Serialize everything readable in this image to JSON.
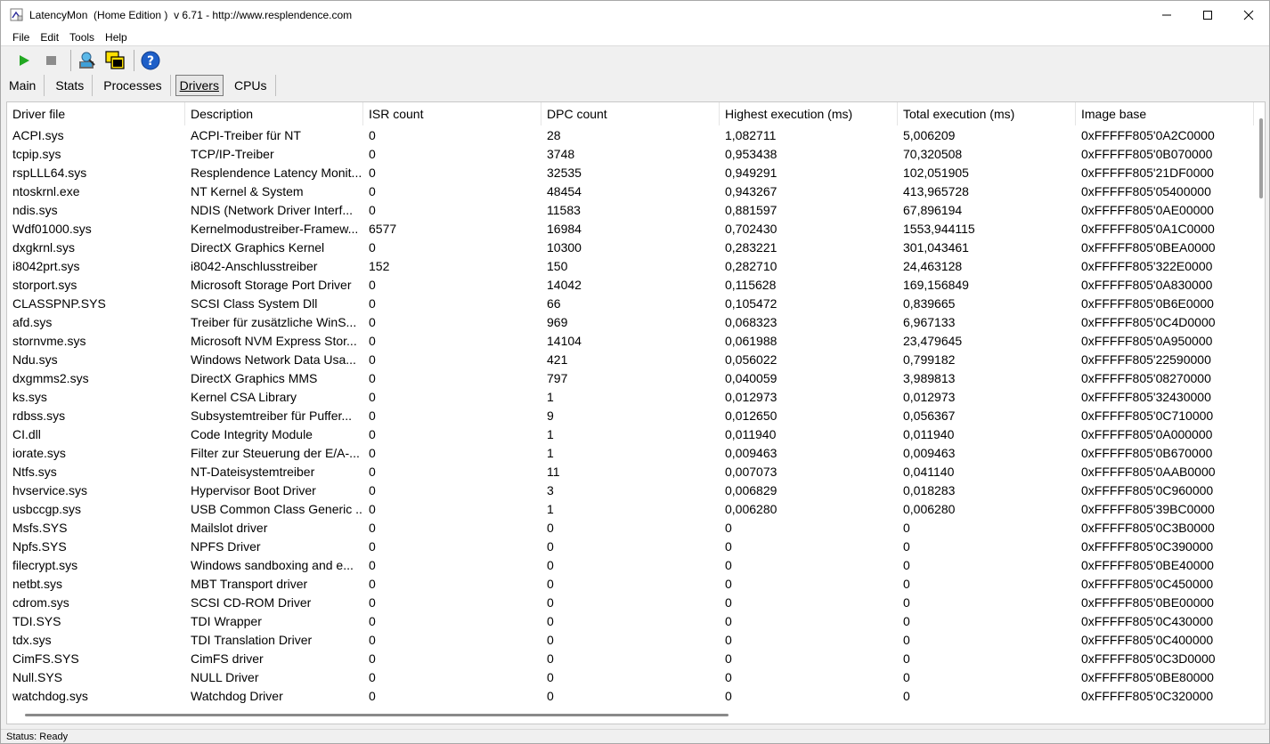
{
  "window": {
    "title": "LatencyMon  (Home Edition )  v 6.71 - http://www.resplendence.com",
    "minimize_glyph": "—",
    "maximize_glyph": "☐",
    "close_glyph": "✕"
  },
  "menu": [
    "File",
    "Edit",
    "Tools",
    "Help"
  ],
  "toolbar": {
    "icons": [
      "start-icon",
      "stop-icon",
      "analyze-icon",
      "windows-icon",
      "help-icon"
    ],
    "colors": {
      "start": "#22a822",
      "stop": "#8c8c8c",
      "help": "#1e5fc8"
    }
  },
  "tabs": [
    "Main",
    "Stats",
    "Processes",
    "Drivers",
    "CPUs"
  ],
  "selected_tab": "Drivers",
  "table": {
    "columns": [
      "Driver file",
      "Description",
      "ISR count",
      "DPC count",
      "Highest execution (ms)",
      "Total execution (ms)",
      "Image base"
    ],
    "rows": [
      [
        "ACPI.sys",
        "ACPI-Treiber für NT",
        "0",
        "28",
        "1,082711",
        "5,006209",
        "0xFFFFF805'0A2C0000"
      ],
      [
        "tcpip.sys",
        "TCP/IP-Treiber",
        "0",
        "3748",
        "0,953438",
        "70,320508",
        "0xFFFFF805'0B070000"
      ],
      [
        "rspLLL64.sys",
        "Resplendence Latency Monit...",
        "0",
        "32535",
        "0,949291",
        "102,051905",
        "0xFFFFF805'21DF0000"
      ],
      [
        "ntoskrnl.exe",
        "NT Kernel & System",
        "0",
        "48454",
        "0,943267",
        "413,965728",
        "0xFFFFF805'05400000"
      ],
      [
        "ndis.sys",
        "NDIS (Network Driver Interf...",
        "0",
        "11583",
        "0,881597",
        "67,896194",
        "0xFFFFF805'0AE00000"
      ],
      [
        "Wdf01000.sys",
        "Kernelmodustreiber-Framew...",
        "6577",
        "16984",
        "0,702430",
        "1553,944115",
        "0xFFFFF805'0A1C0000"
      ],
      [
        "dxgkrnl.sys",
        "DirectX Graphics Kernel",
        "0",
        "10300",
        "0,283221",
        "301,043461",
        "0xFFFFF805'0BEA0000"
      ],
      [
        "i8042prt.sys",
        "i8042-Anschlusstreiber",
        "152",
        "150",
        "0,282710",
        "24,463128",
        "0xFFFFF805'322E0000"
      ],
      [
        "storport.sys",
        "Microsoft Storage Port Driver",
        "0",
        "14042",
        "0,115628",
        "169,156849",
        "0xFFFFF805'0A830000"
      ],
      [
        "CLASSPNP.SYS",
        "SCSI Class System Dll",
        "0",
        "66",
        "0,105472",
        "0,839665",
        "0xFFFFF805'0B6E0000"
      ],
      [
        "afd.sys",
        "Treiber für zusätzliche WinS...",
        "0",
        "969",
        "0,068323",
        "6,967133",
        "0xFFFFF805'0C4D0000"
      ],
      [
        "stornvme.sys",
        "Microsoft NVM Express Stor...",
        "0",
        "14104",
        "0,061988",
        "23,479645",
        "0xFFFFF805'0A950000"
      ],
      [
        "Ndu.sys",
        "Windows Network Data Usa...",
        "0",
        "421",
        "0,056022",
        "0,799182",
        "0xFFFFF805'22590000"
      ],
      [
        "dxgmms2.sys",
        "DirectX Graphics MMS",
        "0",
        "797",
        "0,040059",
        "3,989813",
        "0xFFFFF805'08270000"
      ],
      [
        "ks.sys",
        "Kernel CSA Library",
        "0",
        "1",
        "0,012973",
        "0,012973",
        "0xFFFFF805'32430000"
      ],
      [
        "rdbss.sys",
        "Subsystemtreiber für Puffer...",
        "0",
        "9",
        "0,012650",
        "0,056367",
        "0xFFFFF805'0C710000"
      ],
      [
        "CI.dll",
        "Code Integrity Module",
        "0",
        "1",
        "0,011940",
        "0,011940",
        "0xFFFFF805'0A000000"
      ],
      [
        "iorate.sys",
        "Filter zur Steuerung der E/A-...",
        "0",
        "1",
        "0,009463",
        "0,009463",
        "0xFFFFF805'0B670000"
      ],
      [
        "Ntfs.sys",
        "NT-Dateisystemtreiber",
        "0",
        "11",
        "0,007073",
        "0,041140",
        "0xFFFFF805'0AAB0000"
      ],
      [
        "hvservice.sys",
        "Hypervisor Boot Driver",
        "0",
        "3",
        "0,006829",
        "0,018283",
        "0xFFFFF805'0C960000"
      ],
      [
        "usbccgp.sys",
        "USB Common Class Generic ...",
        "0",
        "1",
        "0,006280",
        "0,006280",
        "0xFFFFF805'39BC0000"
      ],
      [
        "Msfs.SYS",
        "Mailslot driver",
        "0",
        "0",
        "0",
        "0",
        "0xFFFFF805'0C3B0000"
      ],
      [
        "Npfs.SYS",
        "NPFS Driver",
        "0",
        "0",
        "0",
        "0",
        "0xFFFFF805'0C390000"
      ],
      [
        "filecrypt.sys",
        "Windows sandboxing and e...",
        "0",
        "0",
        "0",
        "0",
        "0xFFFFF805'0BE40000"
      ],
      [
        "netbt.sys",
        "MBT Transport driver",
        "0",
        "0",
        "0",
        "0",
        "0xFFFFF805'0C450000"
      ],
      [
        "cdrom.sys",
        "SCSI CD-ROM Driver",
        "0",
        "0",
        "0",
        "0",
        "0xFFFFF805'0BE00000"
      ],
      [
        "TDI.SYS",
        "TDI Wrapper",
        "0",
        "0",
        "0",
        "0",
        "0xFFFFF805'0C430000"
      ],
      [
        "tdx.sys",
        "TDI Translation Driver",
        "0",
        "0",
        "0",
        "0",
        "0xFFFFF805'0C400000"
      ],
      [
        "CimFS.SYS",
        "CimFS driver",
        "0",
        "0",
        "0",
        "0",
        "0xFFFFF805'0C3D0000"
      ],
      [
        "Null.SYS",
        "NULL Driver",
        "0",
        "0",
        "0",
        "0",
        "0xFFFFF805'0BE80000"
      ],
      [
        "watchdog.sys",
        "Watchdog Driver",
        "0",
        "0",
        "0",
        "0",
        "0xFFFFF805'0C320000"
      ]
    ]
  },
  "status": "Status: Ready"
}
